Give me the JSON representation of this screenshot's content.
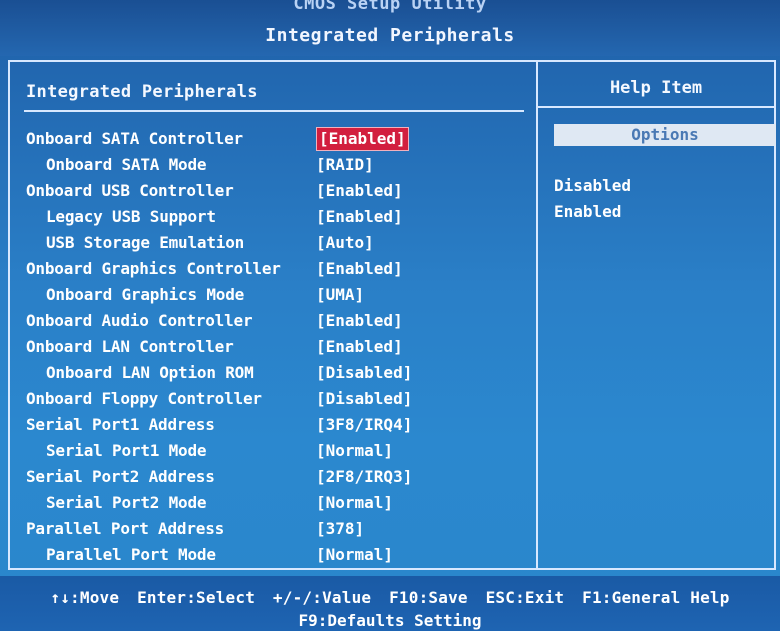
{
  "header": {
    "utility_title": "CMOS Setup Utility",
    "page_title": "Integrated Peripherals"
  },
  "left_pane": {
    "title": "Integrated Peripherals",
    "settings": [
      {
        "label": "Onboard SATA Controller",
        "value": "[Enabled]",
        "selected": true,
        "indent": false
      },
      {
        "label": "Onboard SATA Mode",
        "value": "[RAID]",
        "selected": false,
        "indent": true
      },
      {
        "label": "Onboard USB Controller",
        "value": "[Enabled]",
        "selected": false,
        "indent": false
      },
      {
        "label": "Legacy USB Support",
        "value": "[Enabled]",
        "selected": false,
        "indent": true
      },
      {
        "label": "USB Storage Emulation",
        "value": "[Auto]",
        "selected": false,
        "indent": true
      },
      {
        "label": "Onboard Graphics Controller",
        "value": "[Enabled]",
        "selected": false,
        "indent": false
      },
      {
        "label": "Onboard Graphics Mode",
        "value": "[UMA]",
        "selected": false,
        "indent": true
      },
      {
        "label": "Onboard Audio Controller",
        "value": "[Enabled]",
        "selected": false,
        "indent": false
      },
      {
        "label": "Onboard LAN Controller",
        "value": "[Enabled]",
        "selected": false,
        "indent": false
      },
      {
        "label": "Onboard LAN Option ROM",
        "value": "[Disabled]",
        "selected": false,
        "indent": true
      },
      {
        "label": "Onboard Floppy Controller",
        "value": "[Disabled]",
        "selected": false,
        "indent": false
      },
      {
        "label": "Serial Port1 Address",
        "value": "[3F8/IRQ4]",
        "selected": false,
        "indent": false
      },
      {
        "label": "Serial Port1 Mode",
        "value": "[Normal]",
        "selected": false,
        "indent": true
      },
      {
        "label": "Serial Port2 Address",
        "value": "[2F8/IRQ3]",
        "selected": false,
        "indent": false
      },
      {
        "label": "Serial Port2 Mode",
        "value": "[Normal]",
        "selected": false,
        "indent": true
      },
      {
        "label": "Parallel Port Address",
        "value": "[378]",
        "selected": false,
        "indent": false
      },
      {
        "label": "Parallel Port Mode",
        "value": "[Normal]",
        "selected": false,
        "indent": true
      }
    ]
  },
  "right_pane": {
    "title": "Help Item",
    "options_header": "Options",
    "options": [
      "Disabled",
      "Enabled"
    ]
  },
  "footer": {
    "keys": [
      "↑↓:Move",
      "Enter:Select",
      "+/-/:Value",
      "F10:Save",
      "ESC:Exit",
      "F1:General Help"
    ],
    "line2": "F9:Defaults Setting"
  },
  "colors": {
    "background": "#2a7fc7",
    "highlight": "#d21e3e",
    "options_box": "#dfe8f3",
    "text": "#ffffff"
  }
}
